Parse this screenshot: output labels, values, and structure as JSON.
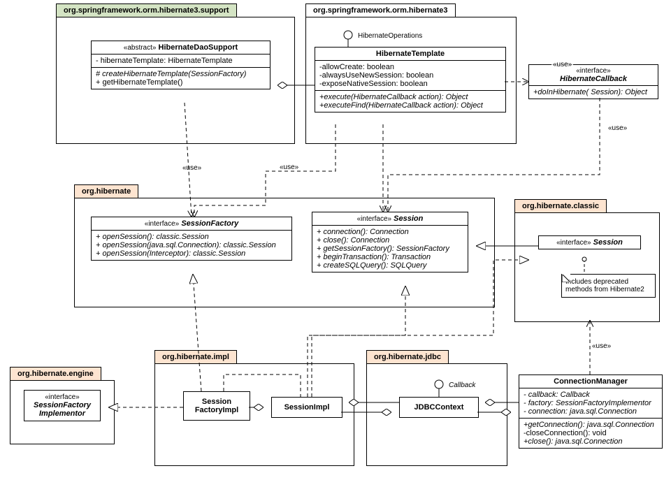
{
  "packages": {
    "support": "org.springframework.orm.hibernate3.support",
    "hibernate3": "org.springframework.orm.hibernate3",
    "hibernate": "org.hibernate",
    "classic": "org.hibernate.classic",
    "impl": "org.hibernate.impl",
    "jdbc": "org.hibernate.jdbc",
    "engine": "org.hibernate.engine"
  },
  "daoSupport": {
    "stereo": "«abstract»",
    "name": "HibernateDaoSupport",
    "attr1": "- hibernateTemplate: HibernateTemplate",
    "op1": "# createHibernateTemplate(SessionFactory)",
    "op2": "+ getHibernateTemplate()"
  },
  "template": {
    "name": "HibernateTemplate",
    "attr1": "-allowCreate: boolean",
    "attr2": "-alwaysUseNewSession: boolean",
    "attr3": "-exposeNativeSession: boolean",
    "op1": "+execute(HibernateCallback action): Object",
    "op2": "+executeFind(HibernateCallback action): Object"
  },
  "callback": {
    "stereo": "«interface»",
    "name": "HibernateCallback",
    "op1": "+doInHibernate( Session): Object"
  },
  "sessionFactory": {
    "stereo": "«interface»",
    "name": "SessionFactory",
    "op1": "+ openSession(): classic.Session",
    "op2": "+ openSession(java.sql.Connection): classic.Session",
    "op3": "+ openSession(Interceptor): classic.Session"
  },
  "session": {
    "stereo": "«interface»",
    "name": "Session",
    "op1": "+ connection(): Connection",
    "op2": "+ close(): Connection",
    "op3": "+ getSessionFactory(): SessionFactory",
    "op4": "+ beginTransaction(): Transaction",
    "op5": "+ createSQLQuery(): SQLQuery"
  },
  "classicSession": {
    "stereo": "«interface»",
    "name": "Session"
  },
  "note": {
    "line1": "Includes deprecated",
    "line2": "methods from Hibernate2"
  },
  "sessionFactoryImpl": {
    "name1": "Session",
    "name2": "FactoryImpl"
  },
  "sessionImpl": {
    "name": "SessionImpl"
  },
  "jdbcContext": {
    "name": "JDBCContext"
  },
  "connMgr": {
    "name": "ConnectionManager",
    "attr1": "- callback: Callback",
    "attr2": "- factory: SessionFactoryImplementor",
    "attr3": "- connection: java.sql.Connection",
    "op1": "+getConnection(): java.sql.Connection",
    "op2": "-closeConnection(): void",
    "op3": "+close(): java.sql.Connection"
  },
  "sfImplementor": {
    "stereo": "«interface»",
    "name1": "SessionFactory",
    "name2": "Implementor"
  },
  "labels": {
    "hibernateOps": "HibernateOperations",
    "callback": "Callback",
    "use": "«use»"
  }
}
